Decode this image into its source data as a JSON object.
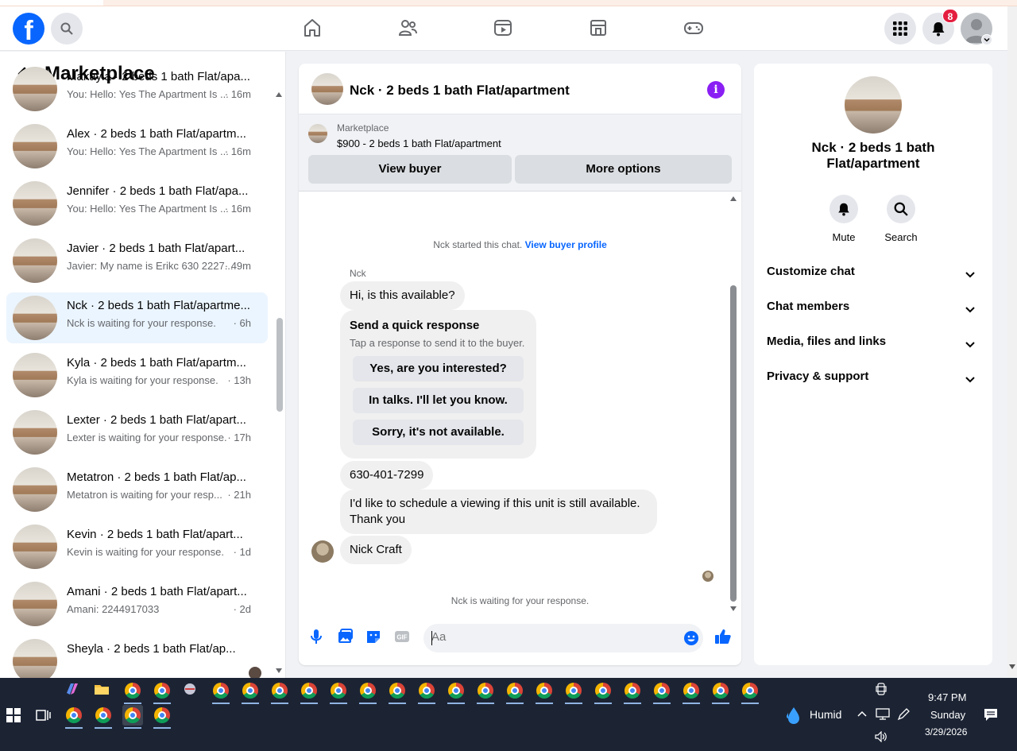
{
  "header": {
    "logo_letter": "f",
    "notification_count": "8"
  },
  "sidebar": {
    "title": "Marketplace",
    "conversations": [
      {
        "title": "Makayla · 2 beds 1 bath Flat/apa...",
        "preview": "You: Hello: Yes The Apartment Is ...",
        "time": "· 16m"
      },
      {
        "title": "Alex · 2 beds 1 bath Flat/apartm...",
        "preview": "You: Hello: Yes The Apartment Is ...",
        "time": "· 16m"
      },
      {
        "title": "Jennifer · 2 beds 1 bath Flat/apa...",
        "preview": "You: Hello: Yes The Apartment Is ...",
        "time": "· 16m"
      },
      {
        "title": "Javier · 2 beds 1 bath Flat/apart...",
        "preview": "Javier: My name is Erikc 630 2227...",
        "time": "· 49m"
      },
      {
        "title": "Nck · 2 beds 1 bath Flat/apartme...",
        "preview": "Nck is waiting for your response.",
        "time": "· 6h"
      },
      {
        "title": "Kyla · 2 beds 1 bath Flat/apartm...",
        "preview": "Kyla is waiting for your response.",
        "time": "· 13h"
      },
      {
        "title": "Lexter · 2 beds 1 bath Flat/apart...",
        "preview": "Lexter is waiting for your response.",
        "time": "· 17h"
      },
      {
        "title": "Metatron · 2 beds 1 bath Flat/ap...",
        "preview": "Metatron is waiting for your resp...",
        "time": "· 21h"
      },
      {
        "title": "Kevin · 2 beds 1 bath Flat/apart...",
        "preview": "Kevin is waiting for your response.",
        "time": "· 1d"
      },
      {
        "title": "Amani · 2 beds 1 bath Flat/apart...",
        "preview": "Amani: 2244917033",
        "time": "· 2d"
      },
      {
        "title": "Sheyla · 2 beds 1 bath Flat/ap...",
        "preview": "",
        "time": ""
      }
    ]
  },
  "chat": {
    "title": "Nck · 2 beds 1 bath Flat/apartment",
    "banner_source": "Marketplace",
    "banner_listing": "$900 - 2 beds 1 bath Flat/apartment",
    "view_buyer": "View buyer",
    "more_options": "More options",
    "started_text": "Nck started this chat.",
    "buyer_profile_link": "View buyer profile",
    "sender_name": "Nck",
    "msg1": "Hi, is this available?",
    "quick_title": "Send a quick response",
    "quick_sub": "Tap a response to send it to the buyer.",
    "quick_options": [
      "Yes, are you interested?",
      "In talks. I'll let you know.",
      "Sorry, it's not available."
    ],
    "msg2": "630-401-7299",
    "msg3_line1": "I'd like to schedule a viewing if this unit is still available.",
    "msg3_line2": "Thank you",
    "msg4": "Nick Craft",
    "waiting_text": "Nck is waiting for your response.",
    "input_placeholder": "Aa"
  },
  "info": {
    "title_line1": "Nck · 2 beds 1 bath",
    "title_line2": "Flat/apartment",
    "mute": "Mute",
    "search": "Search",
    "sections": [
      "Customize chat",
      "Chat members",
      "Media, files and links",
      "Privacy & support"
    ]
  },
  "taskbar": {
    "weather": "Humid",
    "time": "9:47 PM",
    "day": "Sunday",
    "date": "3/29/2026"
  },
  "colors": {
    "brand": "#0866ff",
    "active_row": "#ebf5ff",
    "info_icon": "#8a1ff4",
    "badge": "#e41e3f",
    "taskbar": "#1c2434"
  }
}
